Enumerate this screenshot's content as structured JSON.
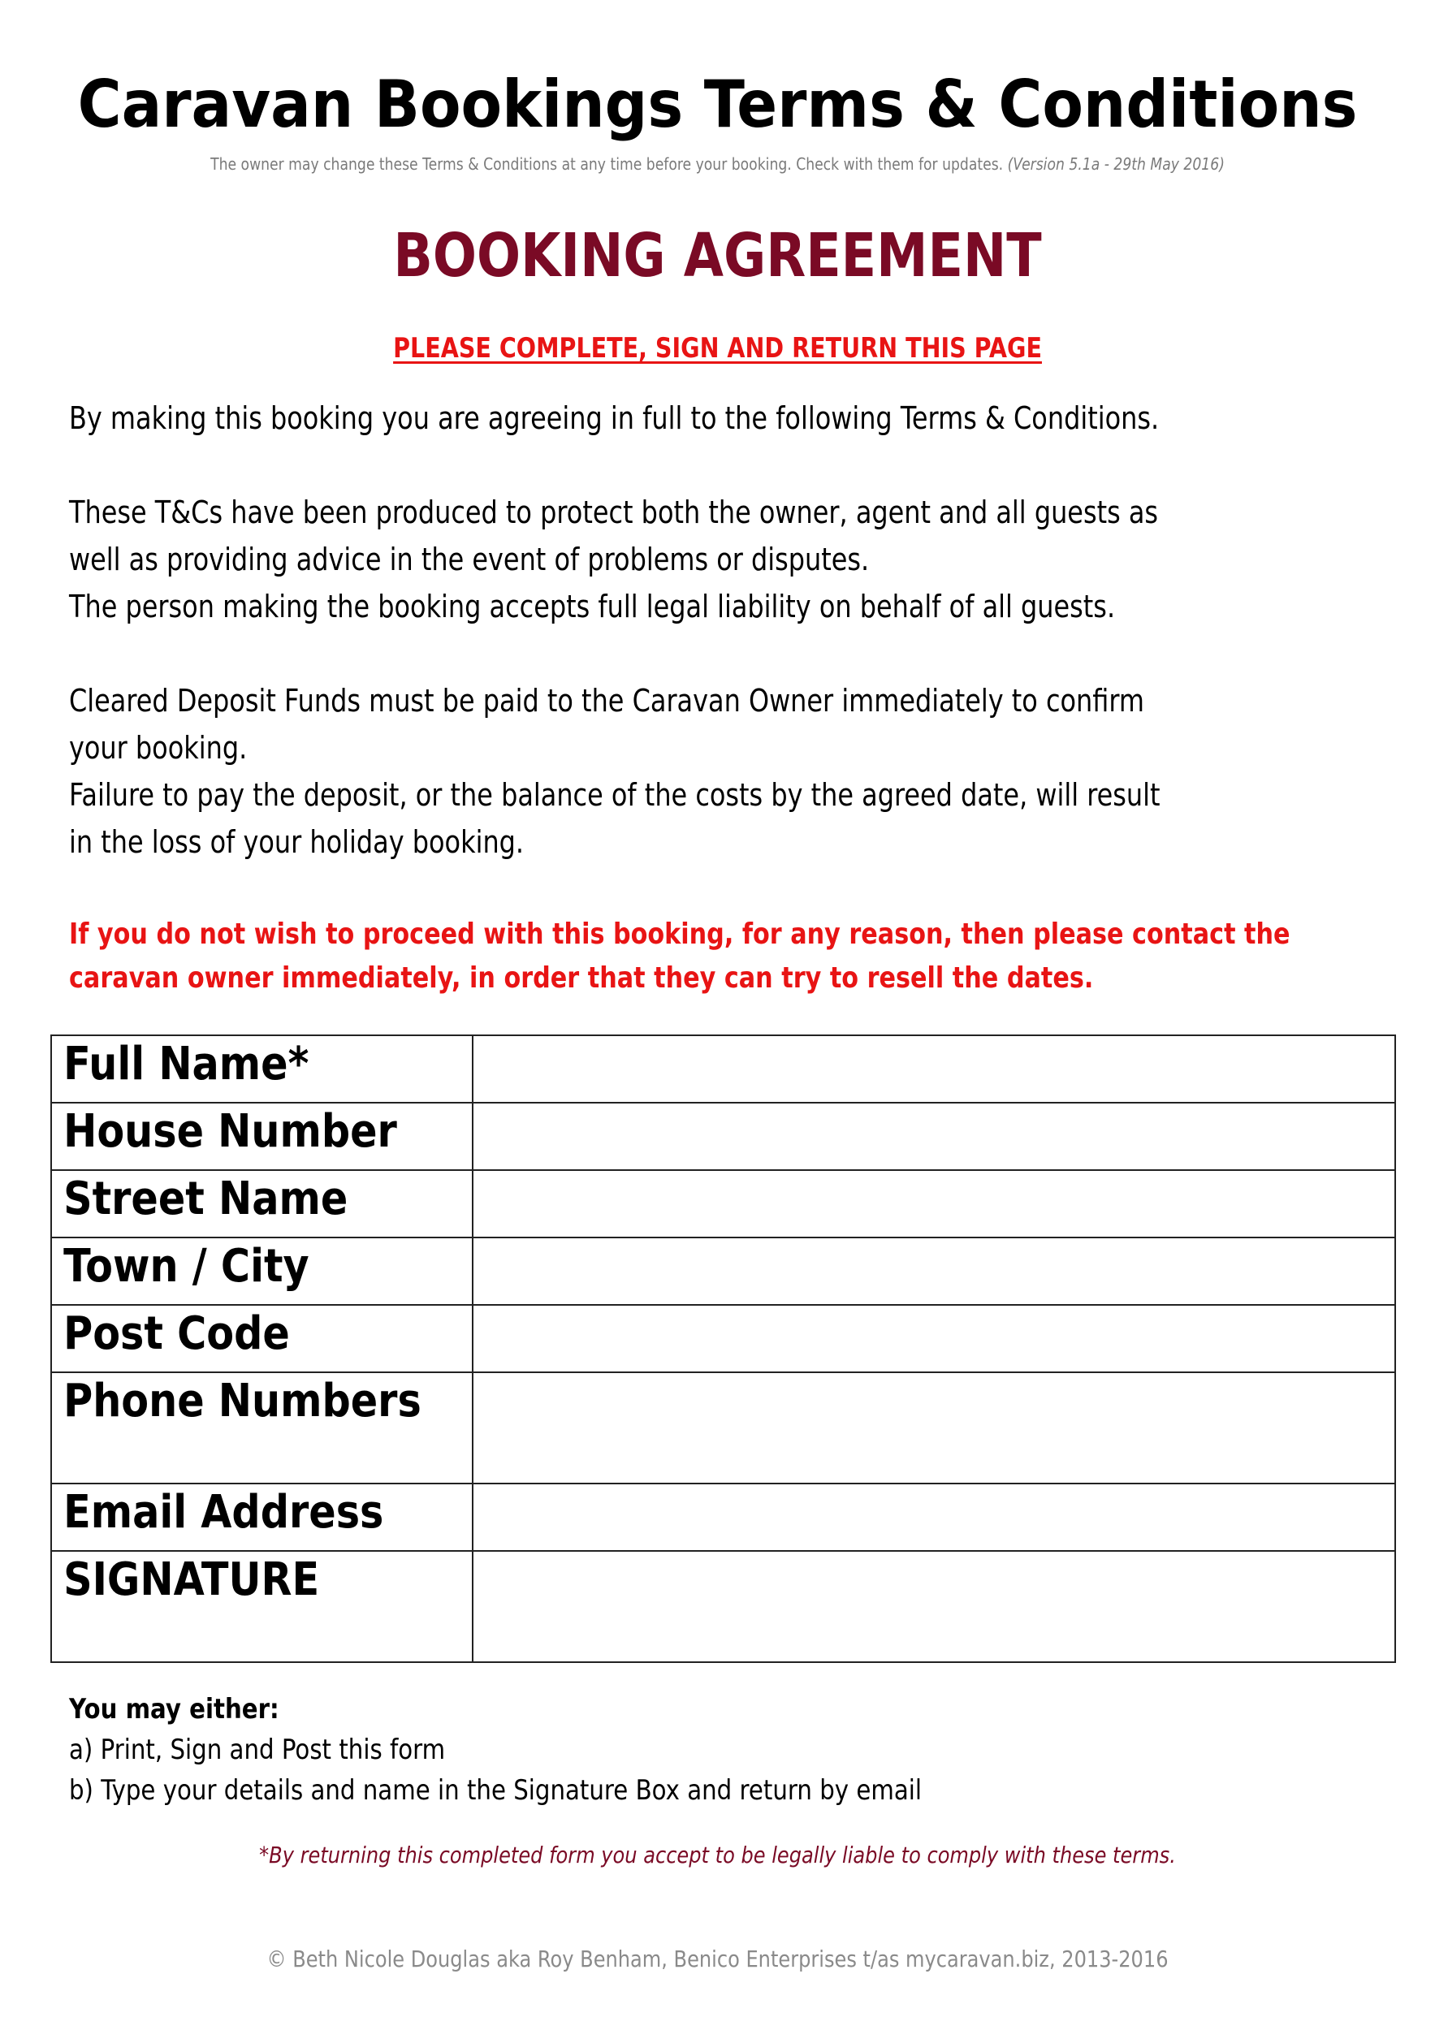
{
  "document": {
    "title": "Caravan Bookings Terms & Conditions",
    "subtitle": "The owner may change these Terms & Conditions at any time before your booking. Check with them for updates.",
    "version": "(Version 5.1a - 29th May 2016)",
    "heading": "BOOKING AGREEMENT",
    "instruction": "PLEASE COMPLETE, SIGN AND RETURN THIS PAGE",
    "paragraphs": [
      [
        "By making this booking you are agreeing in full to the following Terms & Conditions."
      ],
      [
        "These T&Cs have been produced to protect both the owner, agent and all guests as",
        "well as providing advice in the event of problems or disputes.",
        "The person making the booking accepts full legal liability on behalf of all guests."
      ],
      [
        "Cleared Deposit Funds must be paid to the Caravan Owner immediately to confirm",
        "your booking.",
        "Failure to pay the deposit, or the balance of the costs by the agreed date, will result",
        "in the loss of your holiday booking."
      ]
    ],
    "warning": [
      "If you do not wish to proceed with this booking, for any reason, then please contact the",
      "caravan owner immediately, in order that they can try to resell the dates."
    ],
    "colors": {
      "heading": "#7a0a25",
      "alert_red": "#e81414",
      "muted_gray": "#7a7a7a"
    }
  },
  "form": {
    "fields": [
      {
        "label": "Full Name*",
        "value": ""
      },
      {
        "label": "House Number",
        "value": ""
      },
      {
        "label": "Street Name",
        "value": ""
      },
      {
        "label": "Town / City",
        "value": ""
      },
      {
        "label": "Post Code",
        "value": ""
      },
      {
        "label": "Phone Numbers",
        "value": ""
      },
      {
        "label": "Email Address",
        "value": ""
      },
      {
        "label": "SIGNATURE",
        "value": ""
      }
    ]
  },
  "return_options": {
    "lead": "You may either:",
    "options": [
      "a) Print, Sign and Post this form",
      "b) Type your details and name in the Signature Box and return by email"
    ]
  },
  "liability_note": "*By returning this completed form you accept to be legally liable to comply with these terms.",
  "footer": {
    "copyright": "© Beth Nicole Douglas aka Roy Benham, Benico Enterprises t/as mycaravan.biz, 2013-2016"
  }
}
